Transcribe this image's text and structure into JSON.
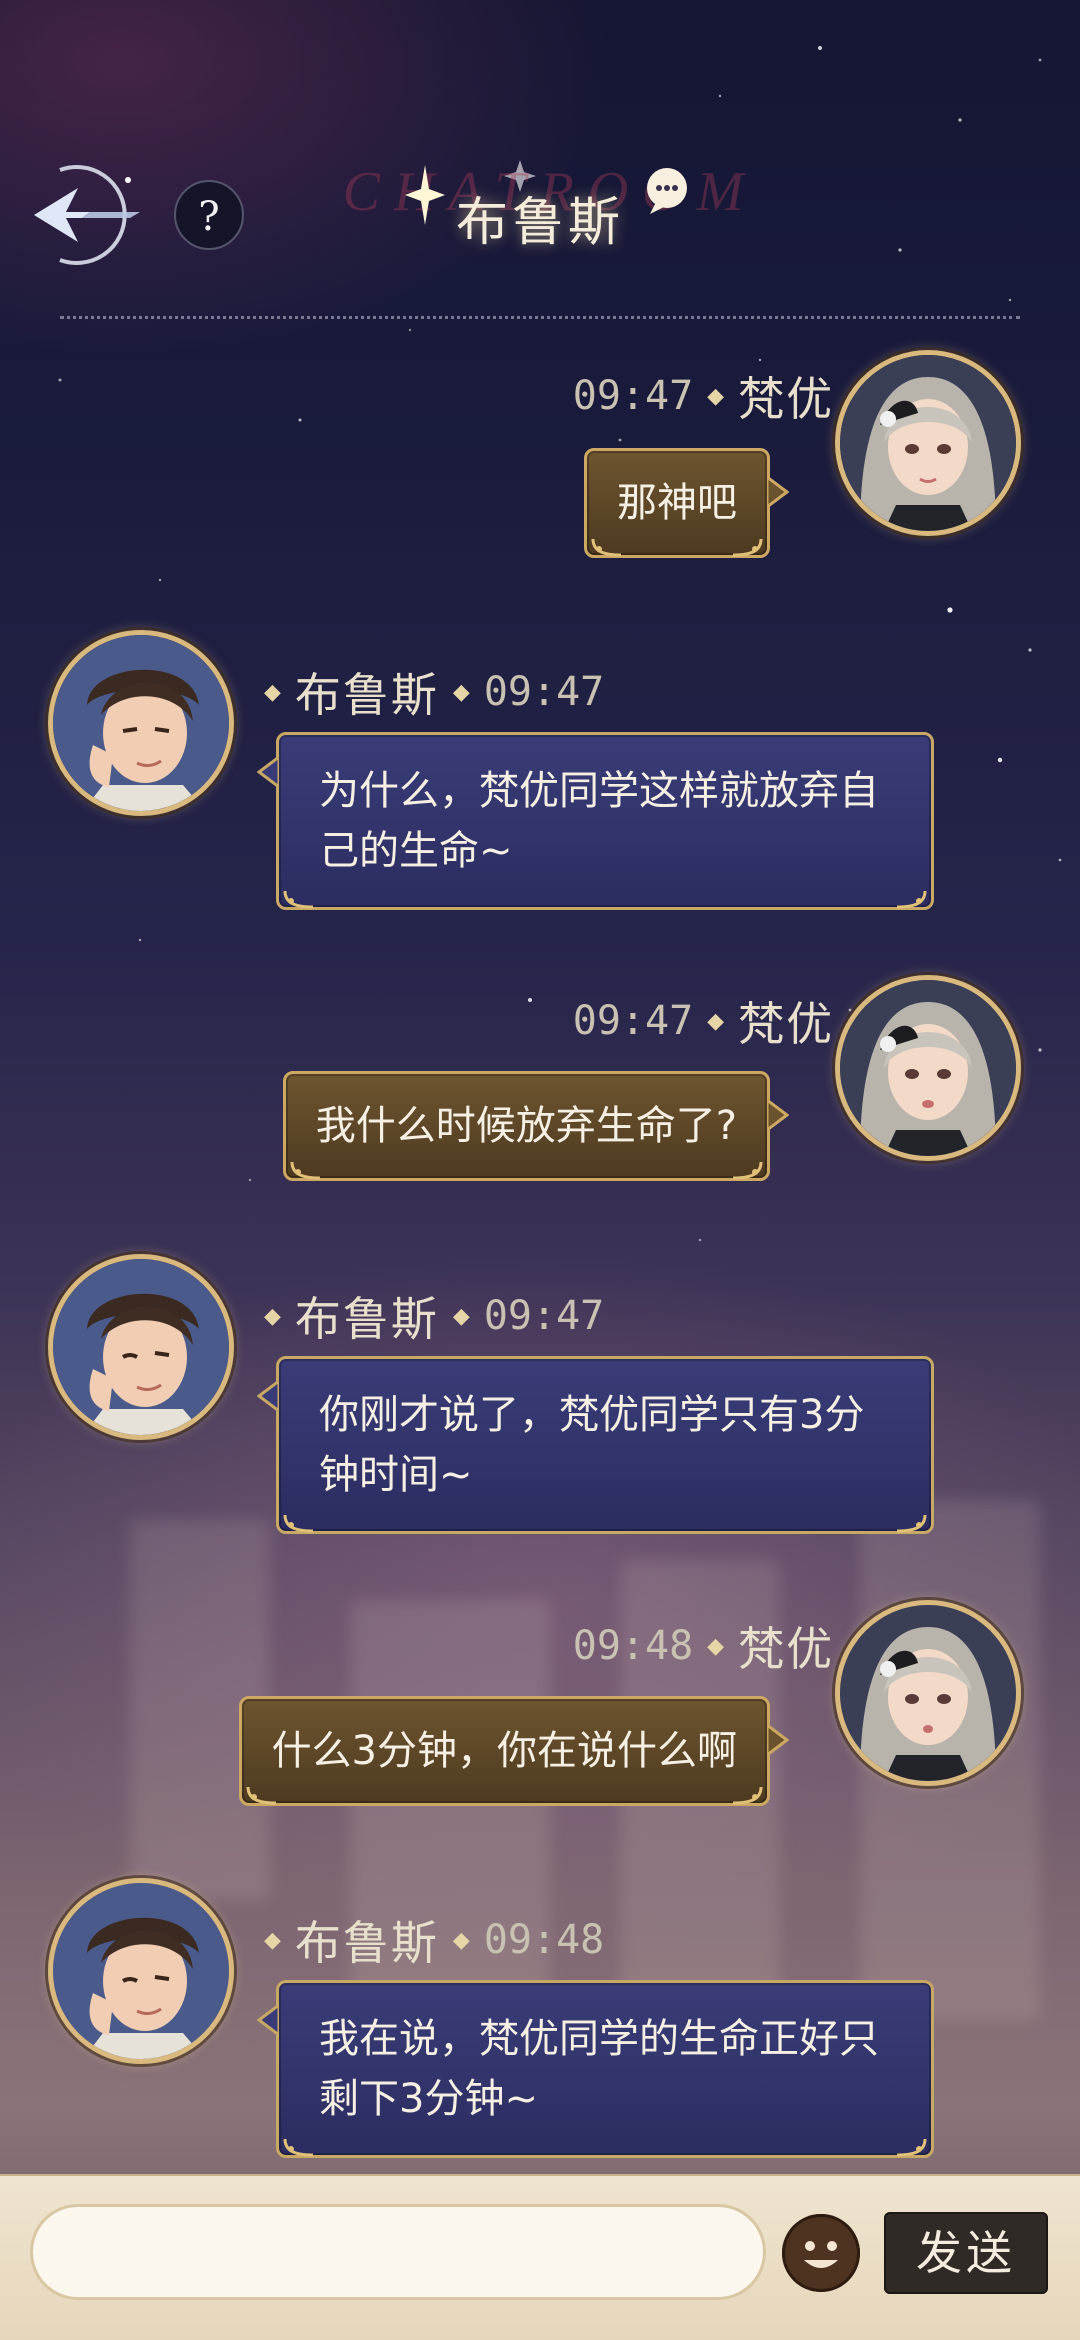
{
  "header": {
    "watermark": "CHATROOM",
    "title": "布鲁斯",
    "help_label": "?"
  },
  "messages": [
    {
      "side": "right",
      "name": "梵优",
      "time": "09:47",
      "text": "那神吧"
    },
    {
      "side": "left",
      "name": "布鲁斯",
      "time": "09:47",
      "text": "为什么，梵优同学这样就放弃自己的生命~"
    },
    {
      "side": "right",
      "name": "梵优",
      "time": "09:47",
      "text": "我什么时候放弃生命了?"
    },
    {
      "side": "left",
      "name": "布鲁斯",
      "time": "09:47",
      "text": "你刚才说了，梵优同学只有3分钟时间~"
    },
    {
      "side": "right",
      "name": "梵优",
      "time": "09:48",
      "text": "什么3分钟，你在说什么啊"
    },
    {
      "side": "left",
      "name": "布鲁斯",
      "time": "09:48",
      "text": "我在说，梵优同学的生命正好只剩下3分钟~"
    }
  ],
  "input": {
    "value": "",
    "placeholder": "",
    "send_label": "发送"
  },
  "colors": {
    "gold_bubble": "#5e4828",
    "blue_bubble": "#33356c",
    "bubble_border": "#cda862",
    "input_bar": "#eadcc2"
  },
  "icons": {
    "back": "back-arrow-icon",
    "help": "help-icon",
    "chat": "chat-bubble-icon",
    "emoji": "emoji-icon"
  }
}
